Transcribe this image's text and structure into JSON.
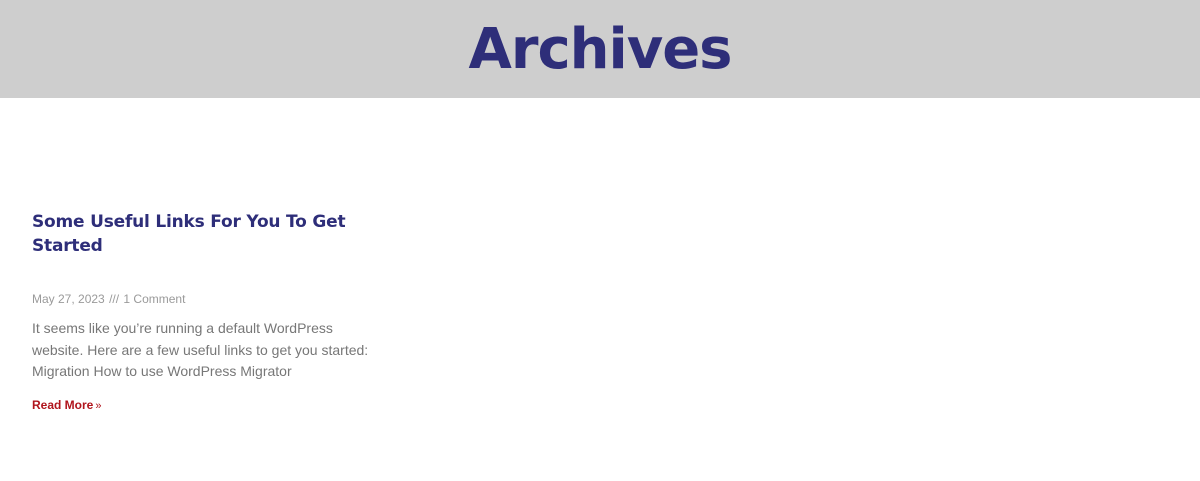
{
  "header": {
    "title": "Archives",
    "background": "#cecece",
    "title_color": "#2e2e79"
  },
  "posts": [
    {
      "title": "Some Useful Links For You To Get Started",
      "date": "May 27, 2023",
      "separator": "///",
      "comments": "1 Comment",
      "excerpt": "It seems like you’re running a default WordPress website. Here are a few useful links to get you started: Migration How to use WordPress Migrator",
      "read_more_label": "Read More",
      "read_more_arrow": "»"
    }
  ],
  "colors": {
    "accent": "#b0141c",
    "meta": "#9a9a9a",
    "body_text": "#777777"
  }
}
